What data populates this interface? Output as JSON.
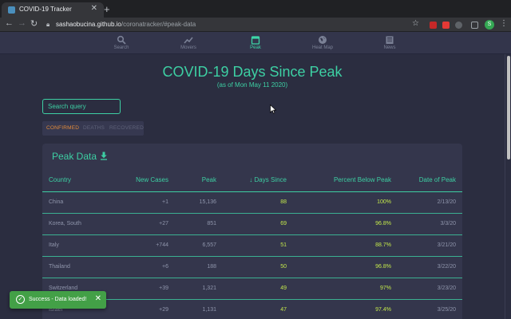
{
  "browser": {
    "tab_title": "COVID-19 Tracker",
    "tab_close": "✕",
    "new_tab": "+",
    "url_host": "sashaobucina.github.io",
    "url_path": "/coronatracker/#peak-data",
    "profile_initial": "S",
    "colors": {
      "chrome_dark": "#202124",
      "chrome": "#35363a"
    }
  },
  "nav": {
    "items": [
      {
        "label": "Search",
        "icon": "search-icon"
      },
      {
        "label": "Movers",
        "icon": "trending-icon"
      },
      {
        "label": "Peak",
        "icon": "calendar-icon"
      },
      {
        "label": "Heat Map",
        "icon": "globe-icon"
      },
      {
        "label": "News",
        "icon": "newspaper-icon"
      }
    ],
    "active": "Peak"
  },
  "page": {
    "title": "COVID-19 Days Since Peak",
    "subtitle": "(as of Mon May 11 2020)"
  },
  "search": {
    "placeholder": "Search query"
  },
  "data_tabs": {
    "items": [
      "CONFIRMED",
      "DEATHS",
      "RECOVERED"
    ],
    "active": "CONFIRMED"
  },
  "table": {
    "title": "Peak Data",
    "headers": {
      "country": "Country",
      "new_cases": "New Cases",
      "peak": "Peak",
      "days_since": "Days Since",
      "percent_below": "Percent Below Peak",
      "date": "Date of Peak"
    },
    "sort_indicator": "↓",
    "rows": [
      {
        "country": "China",
        "new_cases": "+1",
        "peak": "15,136",
        "days_since": "88",
        "percent_below": "100%",
        "date": "2/13/20"
      },
      {
        "country": "Korea, South",
        "new_cases": "+27",
        "peak": "851",
        "days_since": "69",
        "percent_below": "96.8%",
        "date": "3/3/20"
      },
      {
        "country": "Italy",
        "new_cases": "+744",
        "peak": "6,557",
        "days_since": "51",
        "percent_below": "88.7%",
        "date": "3/21/20"
      },
      {
        "country": "Thailand",
        "new_cases": "+6",
        "peak": "188",
        "days_since": "50",
        "percent_below": "96.8%",
        "date": "3/22/20"
      },
      {
        "country": "Switzerland",
        "new_cases": "+39",
        "peak": "1,321",
        "days_since": "49",
        "percent_below": "97%",
        "date": "3/23/20"
      },
      {
        "country": "Israel",
        "new_cases": "+29",
        "peak": "1,131",
        "days_since": "47",
        "percent_below": "97.4%",
        "date": "3/25/20"
      }
    ]
  },
  "toast": {
    "text": "Success - Data loaded!",
    "close": "✕"
  },
  "theme": {
    "background": "#2b2d40",
    "accent": "#3dcfa3",
    "highlight": "#c3e84b",
    "active_tab": "#e28b3a",
    "success": "#43a047"
  }
}
